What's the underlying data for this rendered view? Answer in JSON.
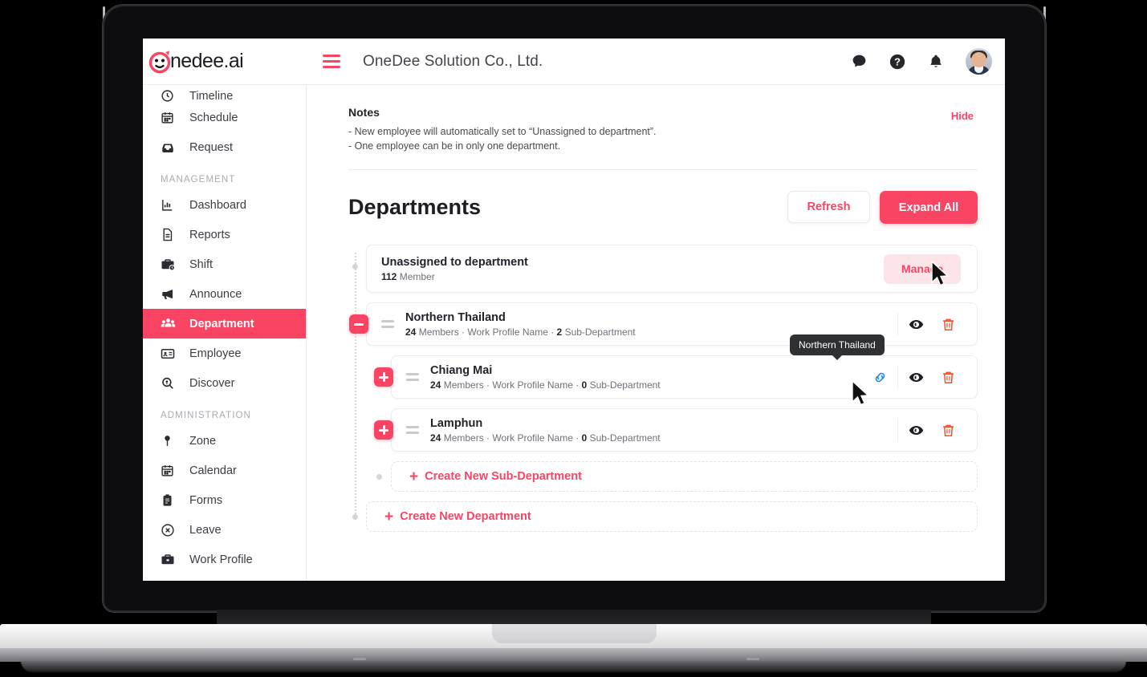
{
  "brand": {
    "logo_text": "nedee.ai",
    "accent": "#FA4463",
    "accent_soft": "#FDE4E9"
  },
  "topbar": {
    "company_title": "OneDee Solution Co., Ltd.",
    "icons": [
      "chat-icon",
      "help-icon",
      "bell-icon",
      "avatar"
    ]
  },
  "sidebar": {
    "items": [
      {
        "label": "Timeline",
        "icon": "clock-icon",
        "active": false
      },
      {
        "label": "Schedule",
        "icon": "calendar-icon",
        "active": false
      },
      {
        "label": "Request",
        "icon": "inbox-icon",
        "active": false
      }
    ],
    "section_management": "MANAGEMENT",
    "management_items": [
      {
        "label": "Dashboard",
        "icon": "chart-icon",
        "active": false
      },
      {
        "label": "Reports",
        "icon": "document-icon",
        "active": false
      },
      {
        "label": "Shift",
        "icon": "briefcase-clock-icon",
        "active": false
      },
      {
        "label": "Announce",
        "icon": "megaphone-icon",
        "active": false
      },
      {
        "label": "Department",
        "icon": "users-icon",
        "active": true
      },
      {
        "label": "Employee",
        "icon": "id-card-icon",
        "active": false
      },
      {
        "label": "Discover",
        "icon": "search-location-icon",
        "active": false
      }
    ],
    "section_administration": "ADMINISTRATION",
    "administration_items": [
      {
        "label": "Zone",
        "icon": "pin-icon",
        "active": false
      },
      {
        "label": "Calendar",
        "icon": "calendar-icon",
        "active": false
      },
      {
        "label": "Forms",
        "icon": "clipboard-icon",
        "active": false
      },
      {
        "label": "Leave",
        "icon": "circle-x-icon",
        "active": false
      },
      {
        "label": "Work Profile",
        "icon": "briefcase-icon",
        "active": false
      }
    ]
  },
  "notes": {
    "title": "Notes",
    "hide_label": "Hide",
    "line1": "- New employee will automatically set to “Unassigned to department”.",
    "line2": "- One employee can be in only one department."
  },
  "departments": {
    "heading": "Departments",
    "refresh_label": "Refresh",
    "expand_all_label": "Expand All",
    "unassigned": {
      "name": "Unassigned to department",
      "count": "112",
      "count_label": "Member",
      "manage_label": "Manage"
    },
    "rows": [
      {
        "name": "Northern Thailand",
        "members": "24",
        "members_label": "Members",
        "work_profile": "Work Profile Name",
        "subcount": "2",
        "sub_label": "Sub-Department",
        "toggle": "minus",
        "level": "parent"
      },
      {
        "name": "Chiang Mai",
        "members": "24",
        "members_label": "Members",
        "work_profile": "Work Profile Name",
        "subcount": "0",
        "sub_label": "Sub-Department",
        "toggle": "plus",
        "level": "child"
      },
      {
        "name": "Lamphun",
        "members": "24",
        "members_label": "Members",
        "work_profile": "Work Profile Name",
        "subcount": "0",
        "sub_label": "Sub-Department",
        "toggle": "plus",
        "level": "child"
      }
    ],
    "create_sub_label": "Create New Sub-Department",
    "create_dept_label": "Create New Department",
    "plus_glyph": "+"
  },
  "tooltip": {
    "text": "Northern Thailand"
  }
}
